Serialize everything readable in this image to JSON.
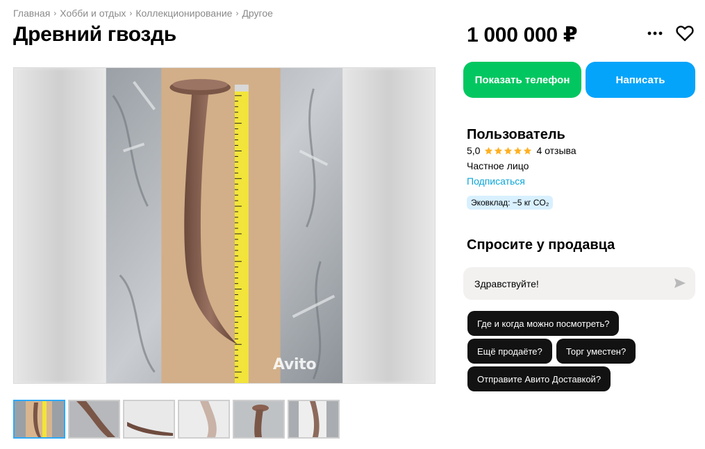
{
  "breadcrumb": [
    "Главная",
    "Хобби и отдых",
    "Коллекционирование",
    "Другое"
  ],
  "listing": {
    "title": "Древний гвоздь",
    "price": "1 000 000 ₽",
    "watermark": "Avito"
  },
  "actions": {
    "show_phone": "Показать телефон",
    "write": "Написать"
  },
  "seller": {
    "name": "Пользователь",
    "rating": "5,0",
    "stars": 5,
    "reviews": "4 отзыва",
    "type": "Частное лицо",
    "subscribe": "Подписаться",
    "eco_badge": "Эковклад: −5 кг CO₂"
  },
  "ask": {
    "title": "Спросите у продавца",
    "input_value": "Здравствуйте!",
    "chips": [
      "Где и когда можно посмотреть?",
      "Ещё продаёте?",
      "Торг уместен?",
      "Отправите Авито Доставкой?"
    ]
  },
  "colors": {
    "green": "#02c760",
    "blue": "#05a4fb",
    "link": "#0aa6d8",
    "star": "#ffb021",
    "thumb_active": "#2ea9f7"
  },
  "icons": {
    "more": "more-dots-icon",
    "favorite": "heart-icon",
    "send": "send-icon",
    "star": "star-icon"
  },
  "thumbnails_count": 6
}
